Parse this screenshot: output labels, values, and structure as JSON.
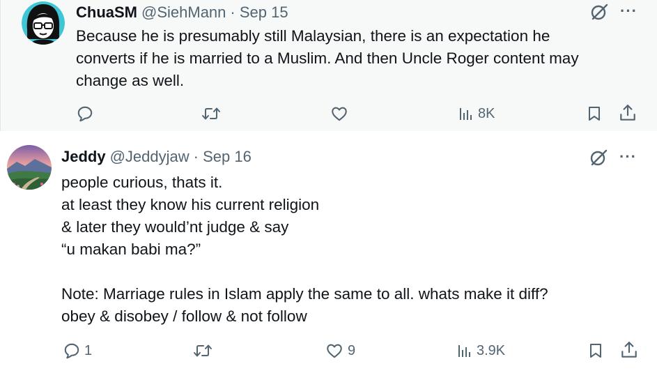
{
  "tweets": [
    {
      "name": "ChuaSM",
      "handle": "@SiehMann",
      "date": "· Sep 15",
      "lines": [
        "Because he is presumably still Malaysian, there is an expectation he",
        "converts if he is married to a Muslim. And then Uncle Roger content may",
        "change as well."
      ],
      "reply_count": "",
      "like_count": "",
      "views": "8K",
      "more": "···"
    },
    {
      "name": "Jeddy",
      "handle": "@Jeddyjaw",
      "date": "· Sep 16",
      "lines": [
        "people curious, thats it.",
        "at least they know his current religion",
        "& later they would’nt judge & say",
        "“u makan babi ma?”",
        "",
        "Note: Marriage rules in Islam apply the same to all. whats make it diff?",
        "obey & disobey / follow & not follow"
      ],
      "reply_count": "1",
      "like_count": "9",
      "views": "3.9K",
      "more": "···"
    }
  ],
  "colors": {
    "text": "#0f1419",
    "secondary": "#536471",
    "highlight_bg": "#f7f9f9"
  },
  "icons": [
    "reply-icon",
    "repost-icon",
    "like-icon",
    "views-icon",
    "bookmark-icon",
    "share-icon",
    "grok-icon",
    "more-icon"
  ]
}
